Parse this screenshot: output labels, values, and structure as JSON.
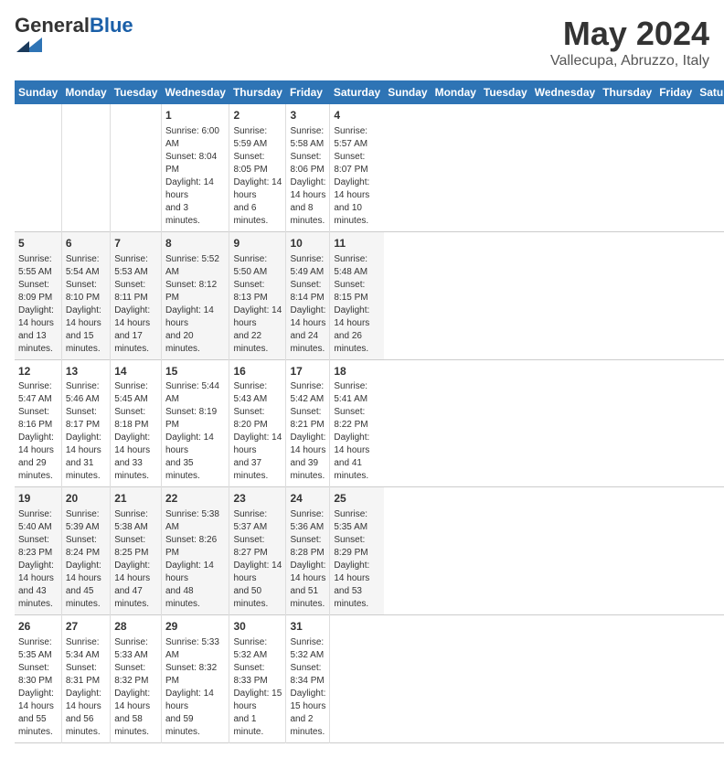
{
  "header": {
    "logo_general": "General",
    "logo_blue": "Blue",
    "main_title": "May 2024",
    "subtitle": "Vallecupa, Abruzzo, Italy"
  },
  "days_of_week": [
    "Sunday",
    "Monday",
    "Tuesday",
    "Wednesday",
    "Thursday",
    "Friday",
    "Saturday"
  ],
  "weeks": [
    [
      {
        "day": "",
        "content": ""
      },
      {
        "day": "",
        "content": ""
      },
      {
        "day": "",
        "content": ""
      },
      {
        "day": "1",
        "content": "Sunrise: 6:00 AM\nSunset: 8:04 PM\nDaylight: 14 hours\nand 3 minutes."
      },
      {
        "day": "2",
        "content": "Sunrise: 5:59 AM\nSunset: 8:05 PM\nDaylight: 14 hours\nand 6 minutes."
      },
      {
        "day": "3",
        "content": "Sunrise: 5:58 AM\nSunset: 8:06 PM\nDaylight: 14 hours\nand 8 minutes."
      },
      {
        "day": "4",
        "content": "Sunrise: 5:57 AM\nSunset: 8:07 PM\nDaylight: 14 hours\nand 10 minutes."
      }
    ],
    [
      {
        "day": "5",
        "content": "Sunrise: 5:55 AM\nSunset: 8:09 PM\nDaylight: 14 hours\nand 13 minutes."
      },
      {
        "day": "6",
        "content": "Sunrise: 5:54 AM\nSunset: 8:10 PM\nDaylight: 14 hours\nand 15 minutes."
      },
      {
        "day": "7",
        "content": "Sunrise: 5:53 AM\nSunset: 8:11 PM\nDaylight: 14 hours\nand 17 minutes."
      },
      {
        "day": "8",
        "content": "Sunrise: 5:52 AM\nSunset: 8:12 PM\nDaylight: 14 hours\nand 20 minutes."
      },
      {
        "day": "9",
        "content": "Sunrise: 5:50 AM\nSunset: 8:13 PM\nDaylight: 14 hours\nand 22 minutes."
      },
      {
        "day": "10",
        "content": "Sunrise: 5:49 AM\nSunset: 8:14 PM\nDaylight: 14 hours\nand 24 minutes."
      },
      {
        "day": "11",
        "content": "Sunrise: 5:48 AM\nSunset: 8:15 PM\nDaylight: 14 hours\nand 26 minutes."
      }
    ],
    [
      {
        "day": "12",
        "content": "Sunrise: 5:47 AM\nSunset: 8:16 PM\nDaylight: 14 hours\nand 29 minutes."
      },
      {
        "day": "13",
        "content": "Sunrise: 5:46 AM\nSunset: 8:17 PM\nDaylight: 14 hours\nand 31 minutes."
      },
      {
        "day": "14",
        "content": "Sunrise: 5:45 AM\nSunset: 8:18 PM\nDaylight: 14 hours\nand 33 minutes."
      },
      {
        "day": "15",
        "content": "Sunrise: 5:44 AM\nSunset: 8:19 PM\nDaylight: 14 hours\nand 35 minutes."
      },
      {
        "day": "16",
        "content": "Sunrise: 5:43 AM\nSunset: 8:20 PM\nDaylight: 14 hours\nand 37 minutes."
      },
      {
        "day": "17",
        "content": "Sunrise: 5:42 AM\nSunset: 8:21 PM\nDaylight: 14 hours\nand 39 minutes."
      },
      {
        "day": "18",
        "content": "Sunrise: 5:41 AM\nSunset: 8:22 PM\nDaylight: 14 hours\nand 41 minutes."
      }
    ],
    [
      {
        "day": "19",
        "content": "Sunrise: 5:40 AM\nSunset: 8:23 PM\nDaylight: 14 hours\nand 43 minutes."
      },
      {
        "day": "20",
        "content": "Sunrise: 5:39 AM\nSunset: 8:24 PM\nDaylight: 14 hours\nand 45 minutes."
      },
      {
        "day": "21",
        "content": "Sunrise: 5:38 AM\nSunset: 8:25 PM\nDaylight: 14 hours\nand 47 minutes."
      },
      {
        "day": "22",
        "content": "Sunrise: 5:38 AM\nSunset: 8:26 PM\nDaylight: 14 hours\nand 48 minutes."
      },
      {
        "day": "23",
        "content": "Sunrise: 5:37 AM\nSunset: 8:27 PM\nDaylight: 14 hours\nand 50 minutes."
      },
      {
        "day": "24",
        "content": "Sunrise: 5:36 AM\nSunset: 8:28 PM\nDaylight: 14 hours\nand 51 minutes."
      },
      {
        "day": "25",
        "content": "Sunrise: 5:35 AM\nSunset: 8:29 PM\nDaylight: 14 hours\nand 53 minutes."
      }
    ],
    [
      {
        "day": "26",
        "content": "Sunrise: 5:35 AM\nSunset: 8:30 PM\nDaylight: 14 hours\nand 55 minutes."
      },
      {
        "day": "27",
        "content": "Sunrise: 5:34 AM\nSunset: 8:31 PM\nDaylight: 14 hours\nand 56 minutes."
      },
      {
        "day": "28",
        "content": "Sunrise: 5:33 AM\nSunset: 8:32 PM\nDaylight: 14 hours\nand 58 minutes."
      },
      {
        "day": "29",
        "content": "Sunrise: 5:33 AM\nSunset: 8:32 PM\nDaylight: 14 hours\nand 59 minutes."
      },
      {
        "day": "30",
        "content": "Sunrise: 5:32 AM\nSunset: 8:33 PM\nDaylight: 15 hours\nand 1 minute."
      },
      {
        "day": "31",
        "content": "Sunrise: 5:32 AM\nSunset: 8:34 PM\nDaylight: 15 hours\nand 2 minutes."
      },
      {
        "day": "",
        "content": ""
      }
    ]
  ]
}
